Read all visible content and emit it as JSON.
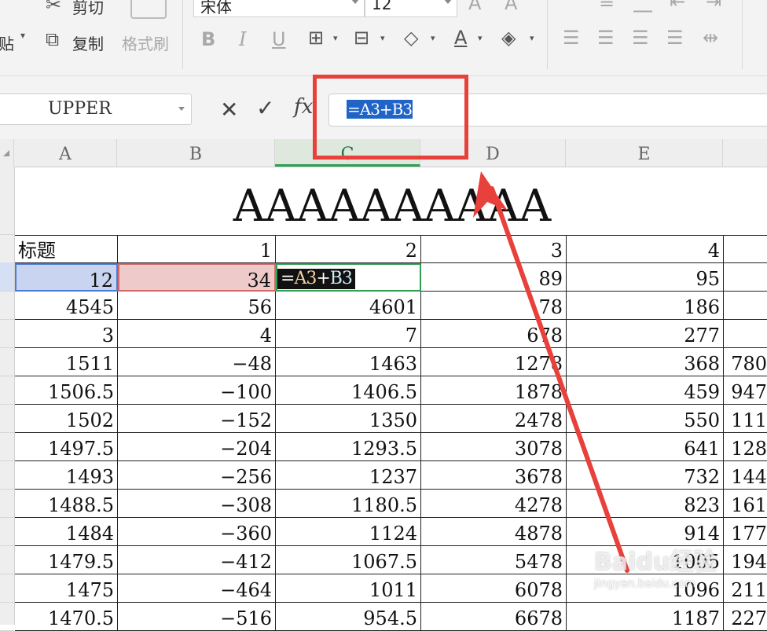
{
  "ribbon": {
    "cut_label": "剪切",
    "paste_label": "贴",
    "copy_label": "复制",
    "format_painter_label": "格式刷",
    "font_name": "宋体",
    "font_size": "12"
  },
  "formula_bar": {
    "name_box": "UPPER",
    "formula": "=A3+B3"
  },
  "columns": [
    "A",
    "B",
    "C",
    "D",
    "E"
  ],
  "active_column": "C",
  "sheet": {
    "title": "AAAAAAAAAA",
    "header_row": [
      "标题",
      "1",
      "2",
      "3",
      "4",
      ""
    ],
    "editing_row": {
      "a": "12",
      "b": "34",
      "formula_eq": "=",
      "formula_a": "A3",
      "formula_plus": "+",
      "formula_b": "B3",
      "d": "89",
      "e": "95",
      "f": ""
    },
    "rows": [
      [
        "4545",
        "56",
        "4601",
        "78",
        "186",
        ""
      ],
      [
        "3",
        "4",
        "7",
        "678",
        "277",
        ""
      ],
      [
        "1511",
        "−48",
        "1463",
        "1278",
        "368",
        "780"
      ],
      [
        "1506.5",
        "−100",
        "1406.5",
        "1878",
        "459",
        "947"
      ],
      [
        "1502",
        "−152",
        "1350",
        "2478",
        "550",
        "111"
      ],
      [
        "1497.5",
        "−204",
        "1293.5",
        "3078",
        "641",
        "128"
      ],
      [
        "1493",
        "−256",
        "1237",
        "3678",
        "732",
        "144"
      ],
      [
        "1488.5",
        "−308",
        "1180.5",
        "4278",
        "823",
        "161"
      ],
      [
        "1484",
        "−360",
        "1124",
        "4878",
        "914",
        "177"
      ],
      [
        "1479.5",
        "−412",
        "1067.5",
        "5478",
        "1005",
        "194"
      ],
      [
        "1475",
        "−464",
        "1011",
        "6078",
        "1096",
        "211"
      ],
      [
        "1470.5",
        "−516",
        "954.5",
        "6678",
        "1187",
        "227"
      ]
    ]
  },
  "watermark": {
    "brand": "Baidu经验",
    "url": "jingyan.baidu.com"
  },
  "colors": {
    "annotation_red": "#e8403a",
    "selection_blue": "#2064c8",
    "active_green": "#2f9e52"
  }
}
